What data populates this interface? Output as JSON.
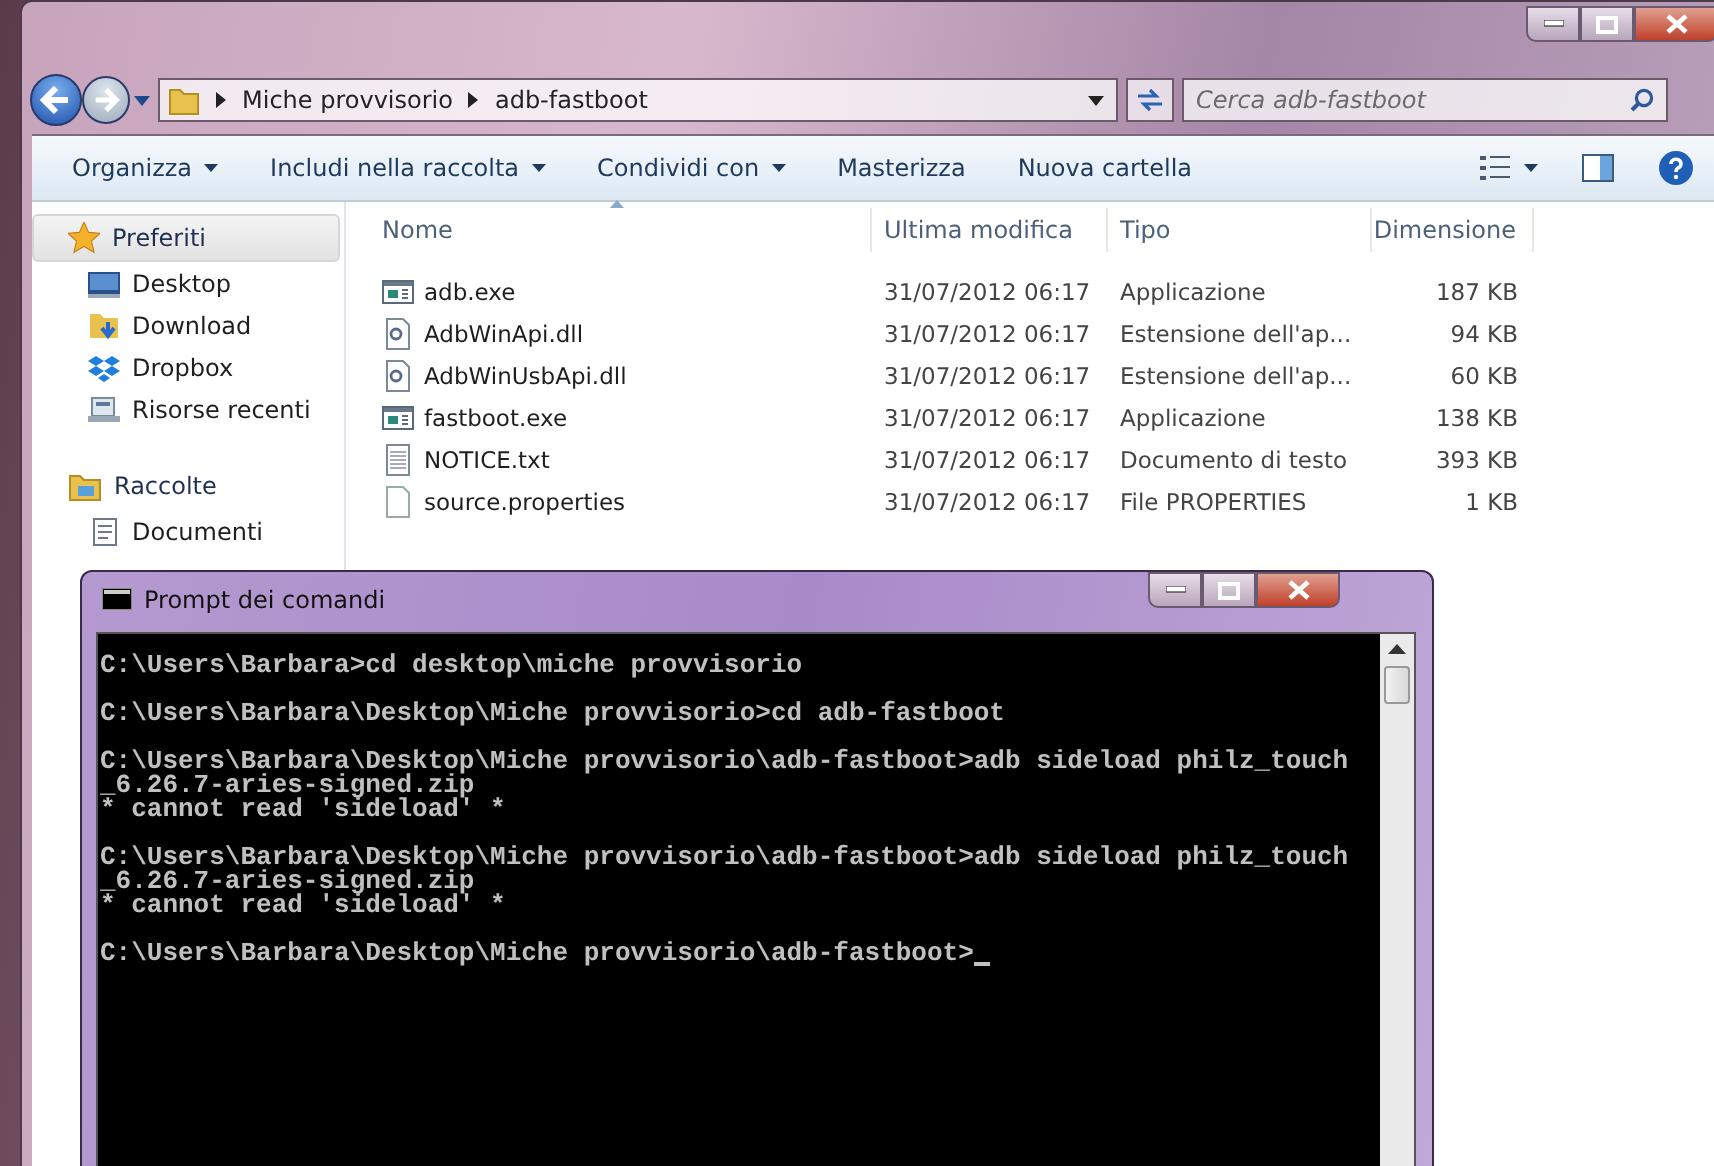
{
  "explorer": {
    "path": [
      "Miche provvisorio",
      "adb-fastboot"
    ],
    "search": {
      "placeholder": "Cerca adb-fastboot"
    },
    "toolbar": [
      {
        "label": "Organizza",
        "dropdown": true
      },
      {
        "label": "Includi nella raccolta",
        "dropdown": true
      },
      {
        "label": "Condividi con",
        "dropdown": true
      },
      {
        "label": "Masterizza",
        "dropdown": false
      },
      {
        "label": "Nuova cartella",
        "dropdown": false
      }
    ],
    "sidebar": [
      {
        "label": "Preferiti",
        "kind": "favorites",
        "selected": true,
        "children": [
          {
            "label": "Desktop",
            "kind": "desktop"
          },
          {
            "label": "Download",
            "kind": "download"
          },
          {
            "label": "Dropbox",
            "kind": "dropbox"
          },
          {
            "label": "Risorse recenti",
            "kind": "recent"
          }
        ]
      },
      {
        "label": "Raccolte",
        "kind": "libraries",
        "selected": false,
        "children": [
          {
            "label": "Documenti",
            "kind": "documents"
          }
        ]
      }
    ],
    "columns": [
      "Nome",
      "Ultima modifica",
      "Tipo",
      "Dimensione"
    ],
    "files": [
      {
        "name": "adb.exe",
        "modified": "31/07/2012 06:17",
        "type": "Applicazione",
        "size": "187 KB",
        "kind": "exe"
      },
      {
        "name": "AdbWinApi.dll",
        "modified": "31/07/2012 06:17",
        "type": "Estensione dell'ap...",
        "size": "94 KB",
        "kind": "dll"
      },
      {
        "name": "AdbWinUsbApi.dll",
        "modified": "31/07/2012 06:17",
        "type": "Estensione dell'ap...",
        "size": "60 KB",
        "kind": "dll"
      },
      {
        "name": "fastboot.exe",
        "modified": "31/07/2012 06:17",
        "type": "Applicazione",
        "size": "138 KB",
        "kind": "exe"
      },
      {
        "name": "NOTICE.txt",
        "modified": "31/07/2012 06:17",
        "type": "Documento di testo",
        "size": "393 KB",
        "kind": "txt"
      },
      {
        "name": "source.properties",
        "modified": "31/07/2012 06:17",
        "type": "File PROPERTIES",
        "size": "1 KB",
        "kind": "file"
      }
    ]
  },
  "cmd": {
    "title": "Prompt dei comandi",
    "cursor": true,
    "blocks": [
      [
        "C:\\Users\\Barbara>cd desktop\\miche provvisorio"
      ],
      [
        "C:\\Users\\Barbara\\Desktop\\Miche provvisorio>cd adb-fastboot"
      ],
      [
        "C:\\Users\\Barbara\\Desktop\\Miche provvisorio\\adb-fastboot>adb sideload philz_touch",
        "_6.26.7-aries-signed.zip",
        "* cannot read 'sideload' *"
      ],
      [
        "C:\\Users\\Barbara\\Desktop\\Miche provvisorio\\adb-fastboot>adb sideload philz_touch",
        "_6.26.7-aries-signed.zip",
        "* cannot read 'sideload' *"
      ],
      [
        "C:\\Users\\Barbara\\Desktop\\Miche provvisorio\\adb-fastboot>"
      ]
    ]
  }
}
